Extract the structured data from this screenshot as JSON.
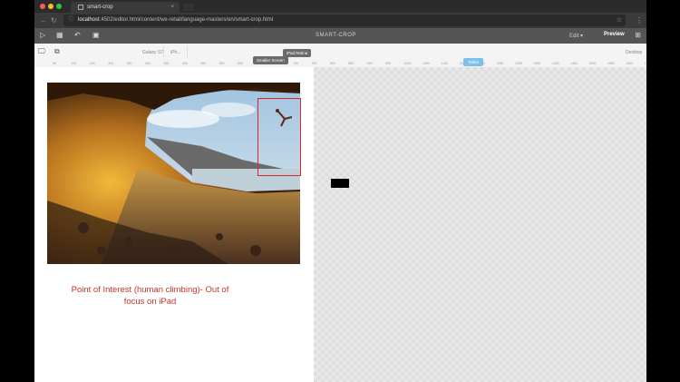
{
  "browser": {
    "tab_title": "smart-crop",
    "tab_close": "×",
    "url_host": "localhost",
    "url_path": ":4502/editor.html/content/we-retail/language-masters/en/smart-crop.html",
    "menu": "⋮"
  },
  "app": {
    "title": "SMART-CROP",
    "edit_label": "Edit",
    "edit_caret": "▾",
    "preview_label": "Preview"
  },
  "devicebar": {
    "device_1": "Galaxy S7",
    "device_2": "iPh...",
    "desktop_label": "Desktop",
    "tooltip_smaller": "Smaller Screen",
    "tooltip_ipad": "iPad Retina",
    "tooltip_tablet": "Tablet"
  },
  "ruler": {
    "ticks": [
      "50",
      "100",
      "150",
      "200",
      "250",
      "300",
      "350",
      "400",
      "450",
      "500",
      "550",
      "600",
      "650",
      "700",
      "750",
      "800",
      "850",
      "900",
      "950",
      "1000",
      "1050",
      "1100",
      "1150",
      "1200",
      "1250",
      "1300",
      "1350",
      "1400",
      "1450",
      "1500",
      "1550",
      "1600",
      "1650"
    ]
  },
  "annotation": {
    "text": "Point of Interest (human climbing)- Out of focus on iPad"
  },
  "colors": {
    "annotation": "#c8322a",
    "crop_box": "#d12a2a",
    "tablet_pill": "#7cc0ee"
  },
  "icons": [
    "monitor-icon",
    "device-icon",
    "grid-icon",
    "undo-icon",
    "layout-icon",
    "settings-icon",
    "reload-icon",
    "info-icon",
    "star-icon"
  ]
}
